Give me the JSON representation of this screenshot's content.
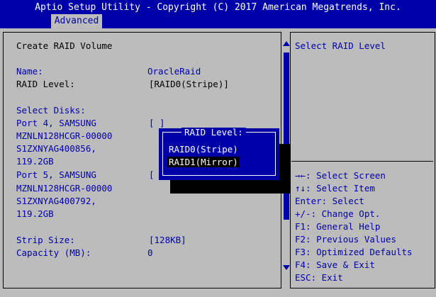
{
  "header": {
    "title": "Aptio Setup Utility - Copyright (C) 2017 American Megatrends, Inc.",
    "tab": "Advanced"
  },
  "form": {
    "heading": "Create RAID Volume",
    "name_label": "Name:",
    "name_value": "OracleRaid",
    "raid_level_label": "RAID Level:",
    "raid_level_value": "[RAID0(Stripe)]",
    "select_disks_label": "Select Disks:",
    "disks": [
      {
        "line1": "Port 4, SAMSUNG",
        "line2": "MZNLN128HCGR-00000",
        "line3": "S1ZXNYAG400856,",
        "line4": "119.2GB",
        "checkbox": "[ ]"
      },
      {
        "line1": "Port 5, SAMSUNG",
        "line2": "MZNLN128HCGR-00000",
        "line3": "S1ZXNYAG400792,",
        "line4": "119.2GB",
        "checkbox": "["
      }
    ],
    "strip_size_label": "Strip Size:",
    "strip_size_value": "[128KB]",
    "capacity_label": "Capacity (MB):",
    "capacity_value": "0"
  },
  "popup": {
    "title": "RAID Level:",
    "options": [
      "RAID0(Stripe)",
      "RAID1(Mirror)"
    ],
    "selected": "RAID1(Mirror)"
  },
  "help": {
    "text": "Select RAID Level",
    "keys": [
      "→←: Select Screen",
      "↑↓: Select Item",
      "Enter: Select",
      "+/-: Change Opt.",
      "F1: General Help",
      "F2: Previous Values",
      "F3: Optimized Defaults",
      "F4: Save & Exit",
      "ESC: Exit"
    ]
  },
  "colors": {
    "background": "#bcbcbc",
    "accent": "#0000a8",
    "text_dark": "#000000",
    "text_light": "#ffffff"
  }
}
